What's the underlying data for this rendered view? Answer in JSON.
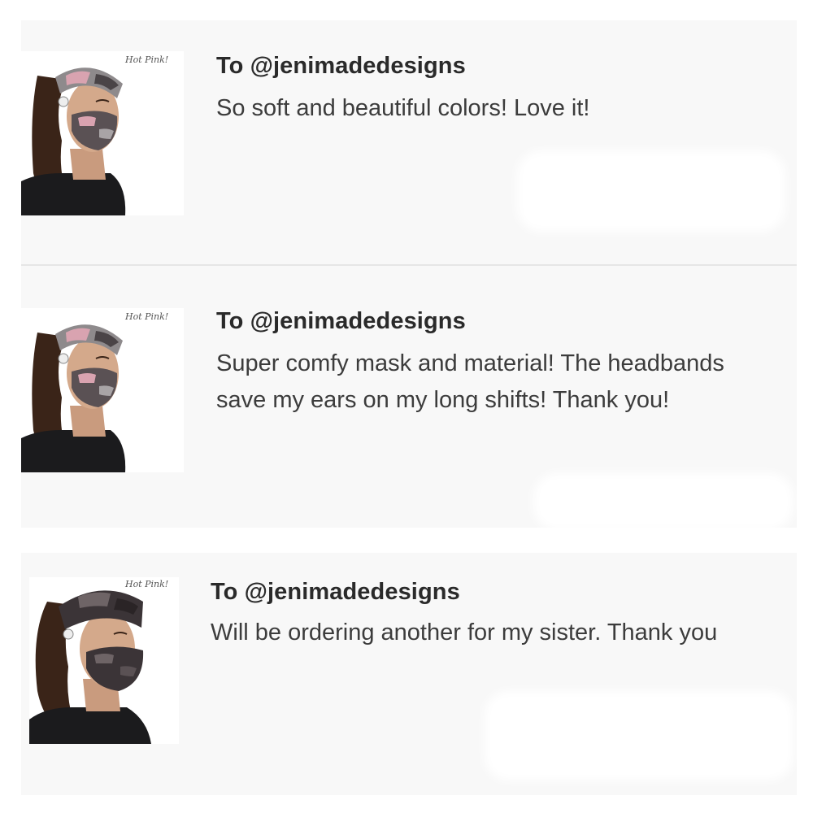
{
  "reviews": [
    {
      "recipient": "To @jenimadedesigns",
      "text": "So soft and beautiful colors! Love it!",
      "watermark": "Hot Pink!"
    },
    {
      "recipient": "To @jenimadedesigns",
      "text": "Super comfy mask and material! The headbands save my ears on my long shifts! Thank you!",
      "watermark": "Hot Pink!"
    },
    {
      "recipient": "To @jenimadedesigns",
      "text": "Will be ordering another for my sister. Thank you",
      "watermark": "Hot Pink!"
    }
  ],
  "colors": {
    "card_background": "#f8f8f8",
    "divider": "#e6e6e6",
    "recipient_text": "#2a2a2a",
    "review_text": "#3c3c3c",
    "camo_pink": "#c9a3ab",
    "camo_dark": "#3b3437"
  }
}
